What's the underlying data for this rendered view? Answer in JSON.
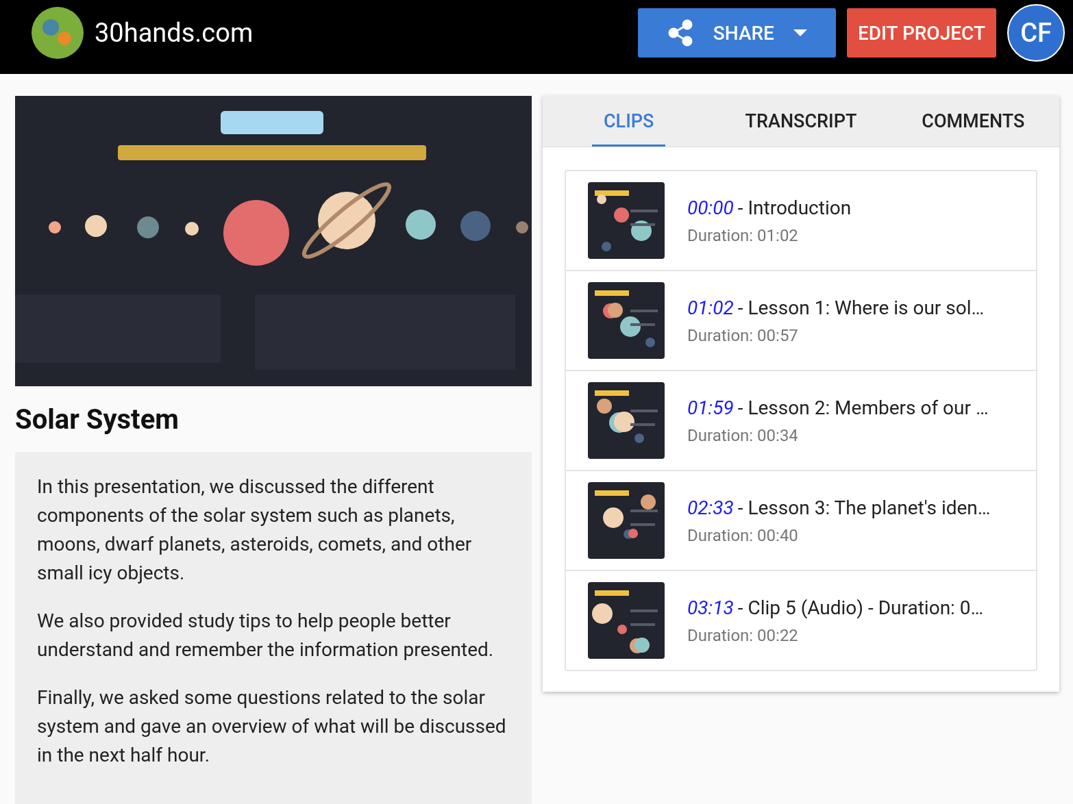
{
  "header": {
    "site_name": "30hands.com",
    "share_button": "SHARE",
    "edit_button": "EDIT PROJECT",
    "avatar": "CF"
  },
  "project": {
    "title": "Solar System",
    "description": [
      "In this presentation, we discussed the different components of the solar system such as planets, moons, dwarf planets, asteroids, comets, and other small icy objects.",
      "We also provided study tips to help people better understand and remember the information presented.",
      "Finally, we asked some questions related to the solar system and gave an overview of what will be discussed in the next half hour."
    ]
  },
  "tabs": [
    {
      "label": "CLIPS",
      "selected": true
    },
    {
      "label": "TRANSCRIPT",
      "selected": false
    },
    {
      "label": "COMMENTS",
      "selected": false
    }
  ],
  "clips": [
    {
      "time": "00:00",
      "title": "- Introduction",
      "duration": "Duration: 01:02"
    },
    {
      "time": "01:02",
      "title": "- Lesson 1: Where is our sol…",
      "duration": "Duration: 00:57"
    },
    {
      "time": "01:59",
      "title": "- Lesson 2: Members of our …",
      "duration": "Duration: 00:34"
    },
    {
      "time": "02:33",
      "title": "- Lesson 3: The planet's iden…",
      "duration": "Duration: 00:40"
    },
    {
      "time": "03:13",
      "title": "- Clip 5 (Audio) - Duration: 0…",
      "duration": "Duration: 00:22"
    }
  ]
}
